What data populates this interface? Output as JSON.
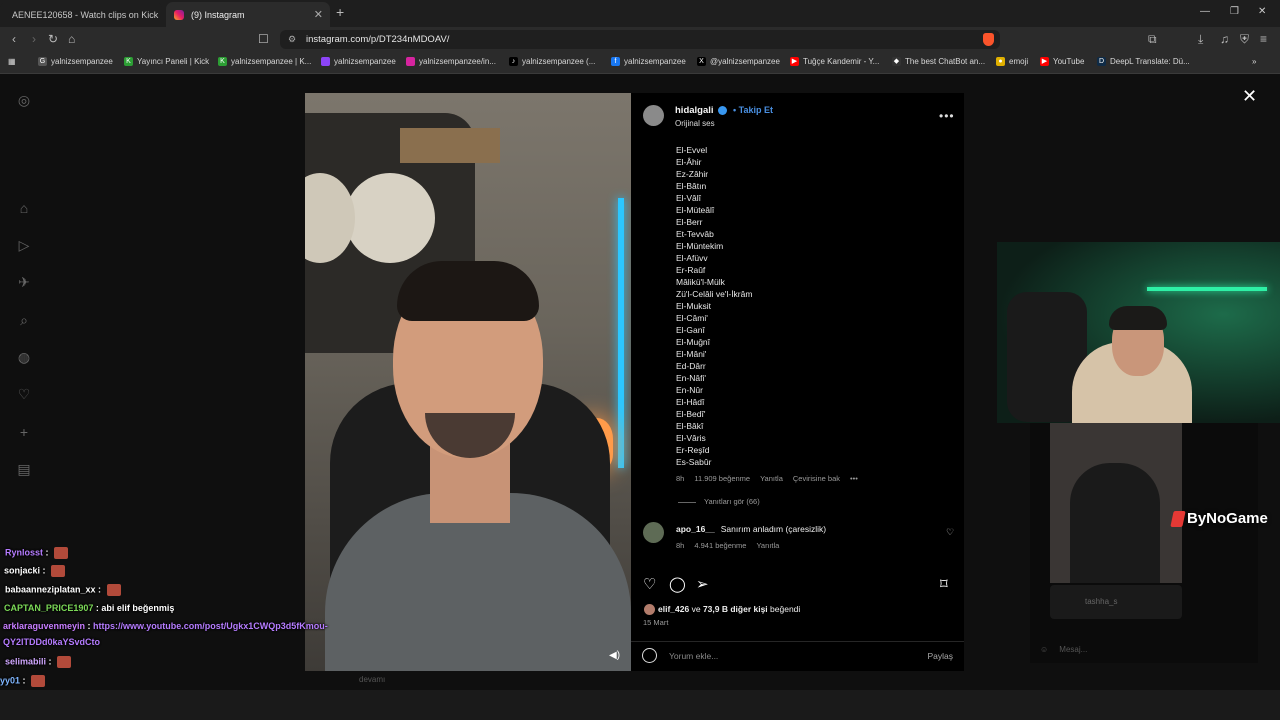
{
  "browser": {
    "tabs": [
      {
        "title": "AENEE120658 - Watch clips on Kick"
      },
      {
        "title": "(9) Instagram"
      }
    ],
    "url": "instagram.com/p/DT234nMDOAV/",
    "bookmarks": [
      "yalnizsempanzee",
      "Yayıncı Paneli | Kick",
      "yalnizsempanzee | K...",
      "yalnizsempanzee",
      "yalnizsempanzee/in...",
      "yalnizsempanzee (...",
      "yalnizsempanzee",
      "@yalnizsempanzee",
      "Tuğçe Kandemir - Y...",
      "The best ChatBot an...",
      "emoji",
      "YouTube",
      "DeepL Translate: Dü..."
    ],
    "colors": {
      "accent": "#3897f0",
      "brave": "#fb542b",
      "neon": "#2cc7ff"
    }
  },
  "post": {
    "username": "hidalgali",
    "follow_label": "Takip Et",
    "audio": "Orijinal ses",
    "names": [
      "El-Evvel",
      "El-Âhir",
      "Ez-Zâhir",
      "El-Bâtın",
      "El-Vâlî",
      "El-Müteâlî",
      "El-Berr",
      "Et-Tevvâb",
      "El-Müntekim",
      "El-Afüvv",
      "Er-Raûf",
      "Mâlikü'l-Mülk",
      "Zü'l-Celâli ve'l-İkrâm",
      "El-Muksit",
      "El-Câmi'",
      "El-Ganî",
      "El-Muğnî",
      "El-Mâni'",
      "Ed-Dârr",
      "En-Nâfi'",
      "En-Nûr",
      "El-Hâdî",
      "El-Bedî'",
      "El-Bâkî",
      "El-Vâris",
      "Er-Reşîd",
      "Es-Sabûr"
    ],
    "caption_meta": {
      "time": "8h",
      "likes": "11.909 beğenme",
      "reply": "Yanıtla",
      "translate": "Çevirisine bak"
    },
    "view_replies": "Yanıtları gör (66)",
    "comment2": {
      "user": "apo_16__",
      "text": "Sanırım anladım (çaresizlik)",
      "time": "8h",
      "likes": "4.941 beğenme",
      "reply": "Yanıtla"
    },
    "likes_line": {
      "user": "elif_426",
      "middle": "ve",
      "count": "73,9 B diğer kişi",
      "end": "beğendi"
    },
    "date": "15 Mart",
    "comment_placeholder": "Yorum ekle...",
    "share_label": "Paylaş"
  },
  "overlay": {
    "brand": "ByNoGame",
    "dm_user": "tashha_s",
    "dm_input": "Mesaj...",
    "video_footer": "devamı"
  },
  "chat": [
    {
      "user": "Rynlosst",
      "text": "",
      "color": "#b57cff"
    },
    {
      "user": "sonjacki",
      "text": "",
      "color": "#ffffff"
    },
    {
      "user": "babaanneziplatan_xx",
      "text": "",
      "color": "#ffffff"
    },
    {
      "user": "CAPTAN_PRICE1907",
      "text": "abi elif beğenmiş",
      "color": "#7bd857"
    },
    {
      "user": "arklaraguvenmeyin",
      "text": "https://www.youtube.com/post/Ugkx1CWQp3d5fKmou-",
      "color": "#c77dff"
    },
    {
      "user": "",
      "text": "QY2lTDDd0kaYSvdCto",
      "color": "#b57cff"
    },
    {
      "user": "selimabili",
      "text": "",
      "color": "#d0a7ff"
    },
    {
      "user": "yy01",
      "text": "",
      "color": "#7fb6ff"
    }
  ]
}
